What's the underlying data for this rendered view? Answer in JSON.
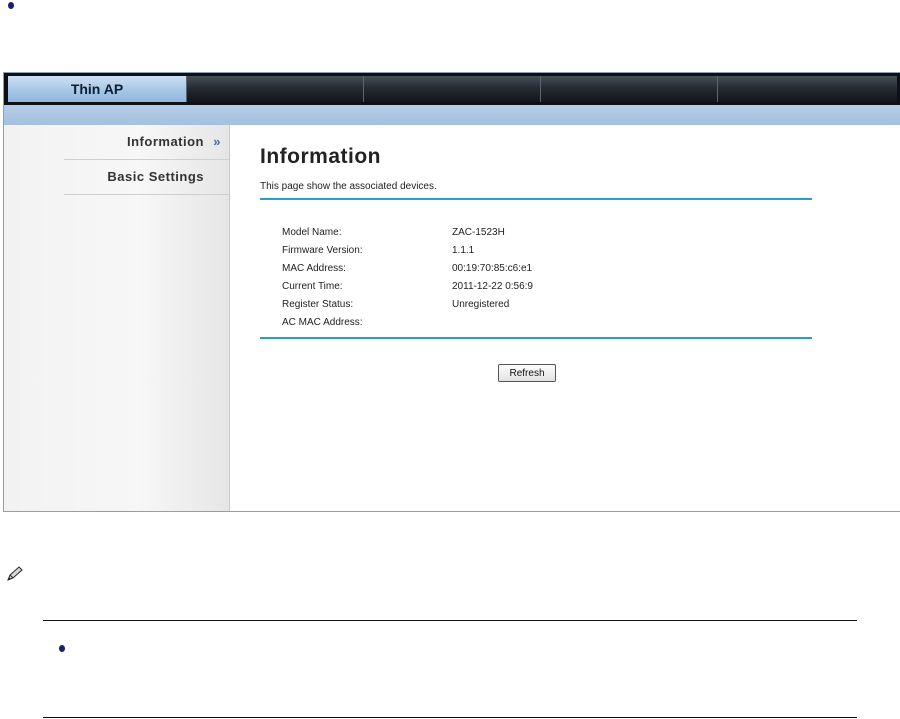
{
  "app": {
    "active_tab": "Thin AP"
  },
  "sidebar": {
    "items": [
      {
        "label": "Information",
        "arrow": "»"
      },
      {
        "label": "Basic Settings"
      }
    ]
  },
  "main": {
    "title": "Information",
    "description": "This page show the associated devices.",
    "fields": [
      {
        "label": "Model Name:",
        "value": "ZAC-1523H"
      },
      {
        "label": "Firmware Version:",
        "value": "1.1.1"
      },
      {
        "label": "MAC Address:",
        "value": "00:19:70:85:c6:e1"
      },
      {
        "label": "Current Time:",
        "value": "2011-12-22 0:56:9"
      },
      {
        "label": "Register Status:",
        "value": "Unregistered"
      },
      {
        "label": "AC MAC Address:",
        "value": ""
      }
    ],
    "refresh_label": "Refresh"
  },
  "colors": {
    "accent_rule": "#2a9ec9",
    "active_tab": "#a6c6e6",
    "bullet": "#1b1f6e"
  },
  "icons": [
    "bullet-icon",
    "pencil-note-icon"
  ]
}
